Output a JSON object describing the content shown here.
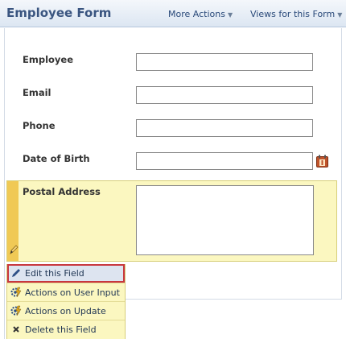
{
  "header": {
    "title": "Employee Form",
    "more_actions": "More Actions",
    "views": "Views for this Form"
  },
  "fields": [
    {
      "label": "Employee",
      "value": ""
    },
    {
      "label": "Email",
      "value": ""
    },
    {
      "label": "Phone",
      "value": ""
    },
    {
      "label": "Date of Birth",
      "value": ""
    }
  ],
  "postal": {
    "label": "Postal Address",
    "value": ""
  },
  "menu": {
    "items": [
      {
        "label": "Edit this Field",
        "icon": "pencil-icon"
      },
      {
        "label": "Actions on User Input",
        "icon": "gear-flash-icon"
      },
      {
        "label": "Actions on Update",
        "icon": "gear-flash-icon"
      },
      {
        "label": "Delete this Field",
        "icon": "delete-x-icon"
      }
    ]
  },
  "colors": {
    "header_title": "#3a5580",
    "highlight_row": "#fbf7c0",
    "accent_strip": "#f0c955",
    "selected_border": "#c8373e"
  }
}
